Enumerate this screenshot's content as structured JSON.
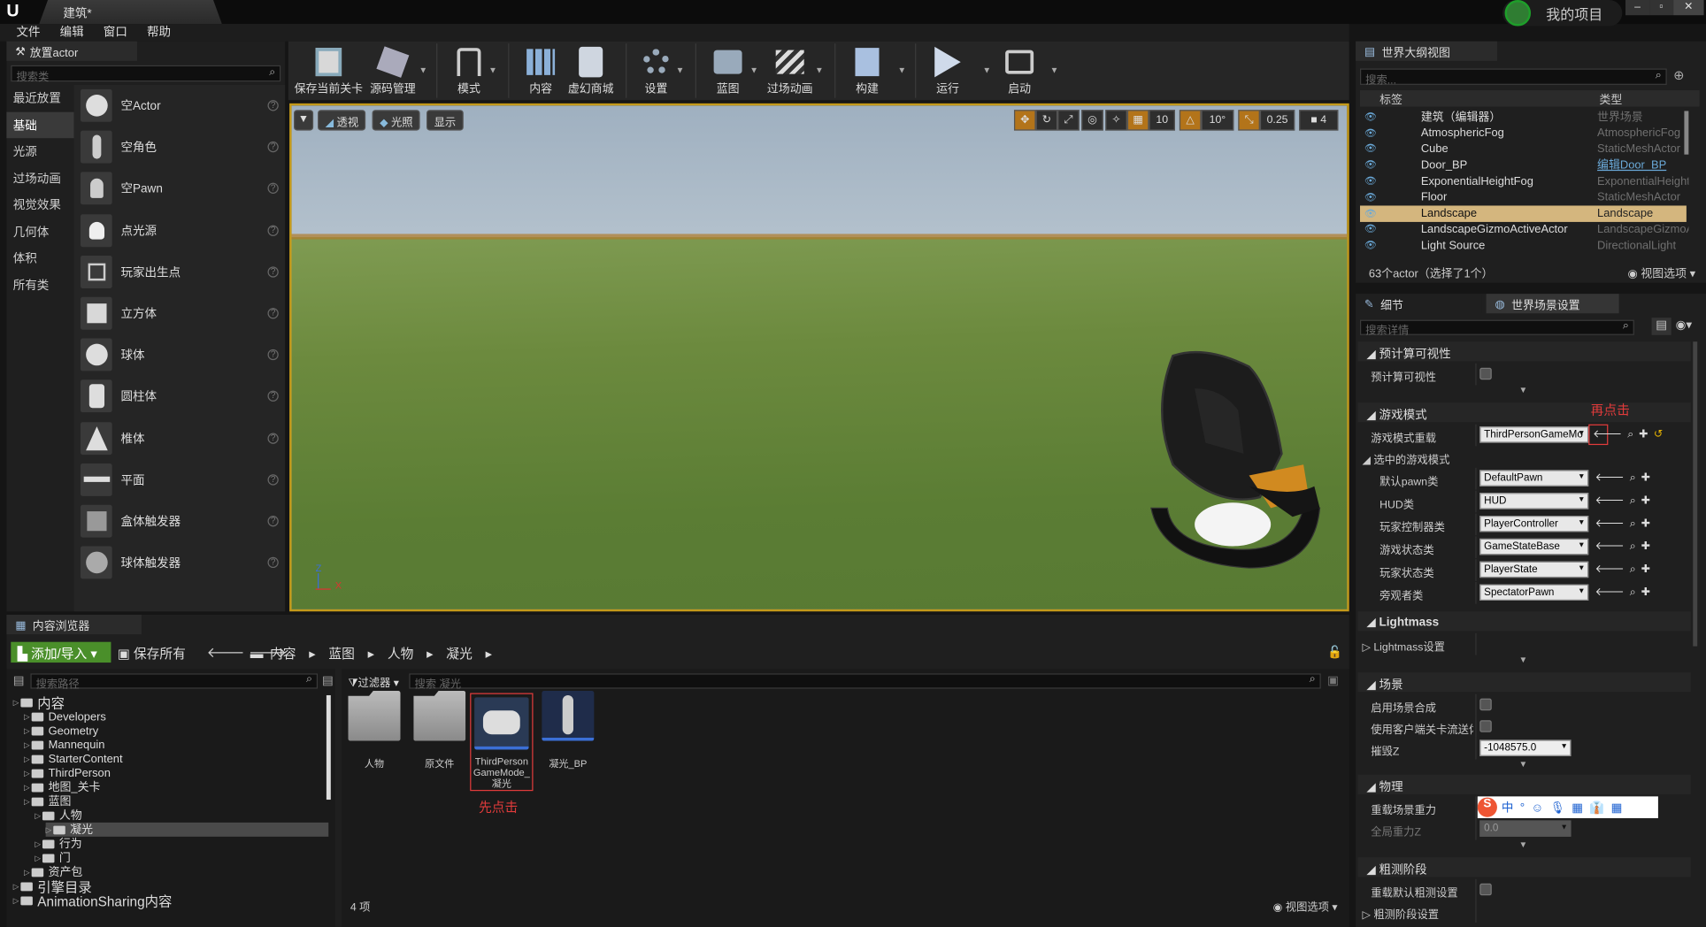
{
  "title_bar": {
    "doc_tab": "建筑*",
    "my_project": "我的项目",
    "win_min": "‒",
    "win_max": "▫",
    "win_close": "✕"
  },
  "menu": [
    "文件",
    "编辑",
    "窗口",
    "帮助"
  ],
  "place_actor": {
    "tab": "放置actor",
    "search_placeholder": "搜索类",
    "categories": [
      "最近放置",
      "基础",
      "光源",
      "过场动画",
      "视觉效果",
      "几何体",
      "体积",
      "所有类"
    ],
    "selected_category": "基础",
    "items": [
      "空Actor",
      "空角色",
      "空Pawn",
      "点光源",
      "玩家出生点",
      "立方体",
      "球体",
      "圆柱体",
      "椎体",
      "平面",
      "盒体触发器",
      "球体触发器"
    ]
  },
  "toolbar": {
    "buttons": [
      "保存当前关卡",
      "源码管理",
      "模式",
      "内容",
      "虚幻商城",
      "设置",
      "蓝图",
      "过场动画",
      "构建",
      "运行",
      "启动"
    ]
  },
  "viewport": {
    "dropdown": "▼",
    "perspective": "透视",
    "lit": "光照",
    "show": "显示",
    "grid_snap": "10",
    "rot_snap": "10°",
    "scale_snap": "0.25",
    "cam_speed": "4",
    "axis_z": "Z",
    "axis_x": "X"
  },
  "outliner": {
    "tab": "世界大纲视图",
    "search_placeholder": "搜索...",
    "col_label": "标签",
    "col_type": "类型",
    "rows": [
      {
        "name": "建筑（编辑器）",
        "type": "世界场景",
        "sel": false
      },
      {
        "name": "AtmosphericFog",
        "type": "AtmosphericFog",
        "sel": false
      },
      {
        "name": "Cube",
        "type": "StaticMeshActor",
        "sel": false
      },
      {
        "name": "Door_BP",
        "type": "编辑Door_BP",
        "sel": false
      },
      {
        "name": "ExponentialHeightFog",
        "type": "ExponentialHeight",
        "sel": false
      },
      {
        "name": "Floor",
        "type": "StaticMeshActor",
        "sel": false
      },
      {
        "name": "Landscape",
        "type": "Landscape",
        "sel": true
      },
      {
        "name": "LandscapeGizmoActiveActor",
        "type": "LandscapeGizmoA",
        "sel": false
      },
      {
        "name": "Light Source",
        "type": "DirectionalLight",
        "sel": false
      }
    ],
    "count": "63个actor（选择了1个）",
    "view_options": "视图选项"
  },
  "details": {
    "tab_details": "细节",
    "tab_world": "世界场景设置",
    "search_placeholder": "搜索详情",
    "sec_precomputed": "预计算可视性",
    "prop_precomputed": "预计算可视性",
    "sec_gamemode": "游戏模式",
    "annotation_second": "再点击",
    "prop_gm_override": "游戏模式重载",
    "gm_override_value": "ThirdPersonGameMo",
    "sub_selected_gm": "选中的游戏模式",
    "gm_props": [
      {
        "label": "默认pawn类",
        "value": "DefaultPawn"
      },
      {
        "label": "HUD类",
        "value": "HUD"
      },
      {
        "label": "玩家控制器类",
        "value": "PlayerController"
      },
      {
        "label": "游戏状态类",
        "value": "GameStateBase"
      },
      {
        "label": "玩家状态类",
        "value": "PlayerState"
      },
      {
        "label": "旁观者类",
        "value": "SpectatorPawn"
      }
    ],
    "sec_lightmass": "Lightmass",
    "prop_lightmass": "Lightmass设置",
    "sec_world": "场景",
    "prop_world_comp": "启用场景合成",
    "prop_client_stream": "使用客户端关卡流送体积",
    "prop_kill_z": "摧毁Z",
    "kill_z_value": "-1048575.0",
    "sec_physics": "物理",
    "prop_override_gravity": "重载场景重力",
    "prop_global_gravity": "全局重力Z",
    "global_gravity_value": "0.0",
    "ime_text": "中",
    "sec_broadphase": "粗测阶段",
    "prop_override_broadphase": "重载默认粗测设置",
    "prop_broadphase_settings": "粗测阶段设置"
  },
  "content_browser": {
    "tab": "内容浏览器",
    "add_import": "添加/导入",
    "save_all": "保存所有",
    "breadcrumb": [
      "内容",
      "蓝图",
      "人物",
      "凝光"
    ],
    "path_search_placeholder": "搜索路径",
    "filter": "过滤器",
    "asset_search_placeholder": "搜索 凝光",
    "tree": [
      {
        "label": "内容",
        "indent": 0,
        "big": true
      },
      {
        "label": "Developers",
        "indent": 1
      },
      {
        "label": "Geometry",
        "indent": 1
      },
      {
        "label": "Mannequin",
        "indent": 1
      },
      {
        "label": "StarterContent",
        "indent": 1
      },
      {
        "label": "ThirdPerson",
        "indent": 1
      },
      {
        "label": "地图_关卡",
        "indent": 1
      },
      {
        "label": "蓝图",
        "indent": 1
      },
      {
        "label": "人物",
        "indent": 2
      },
      {
        "label": "凝光",
        "indent": 3,
        "sel": true
      },
      {
        "label": "行为",
        "indent": 2
      },
      {
        "label": "门",
        "indent": 2
      },
      {
        "label": "资产包",
        "indent": 1
      },
      {
        "label": "引擎目录",
        "indent": 0,
        "big": true
      },
      {
        "label": "AnimationSharing内容",
        "indent": 0,
        "big": true
      }
    ],
    "assets": [
      {
        "name": "人物"
      },
      {
        "name": "原文件"
      },
      {
        "name": "ThirdPerson GameMode_ 凝光"
      },
      {
        "name": "凝光_BP"
      }
    ],
    "annotation_first": "先点击",
    "item_count": "4 项",
    "view_options": "视图选项"
  }
}
